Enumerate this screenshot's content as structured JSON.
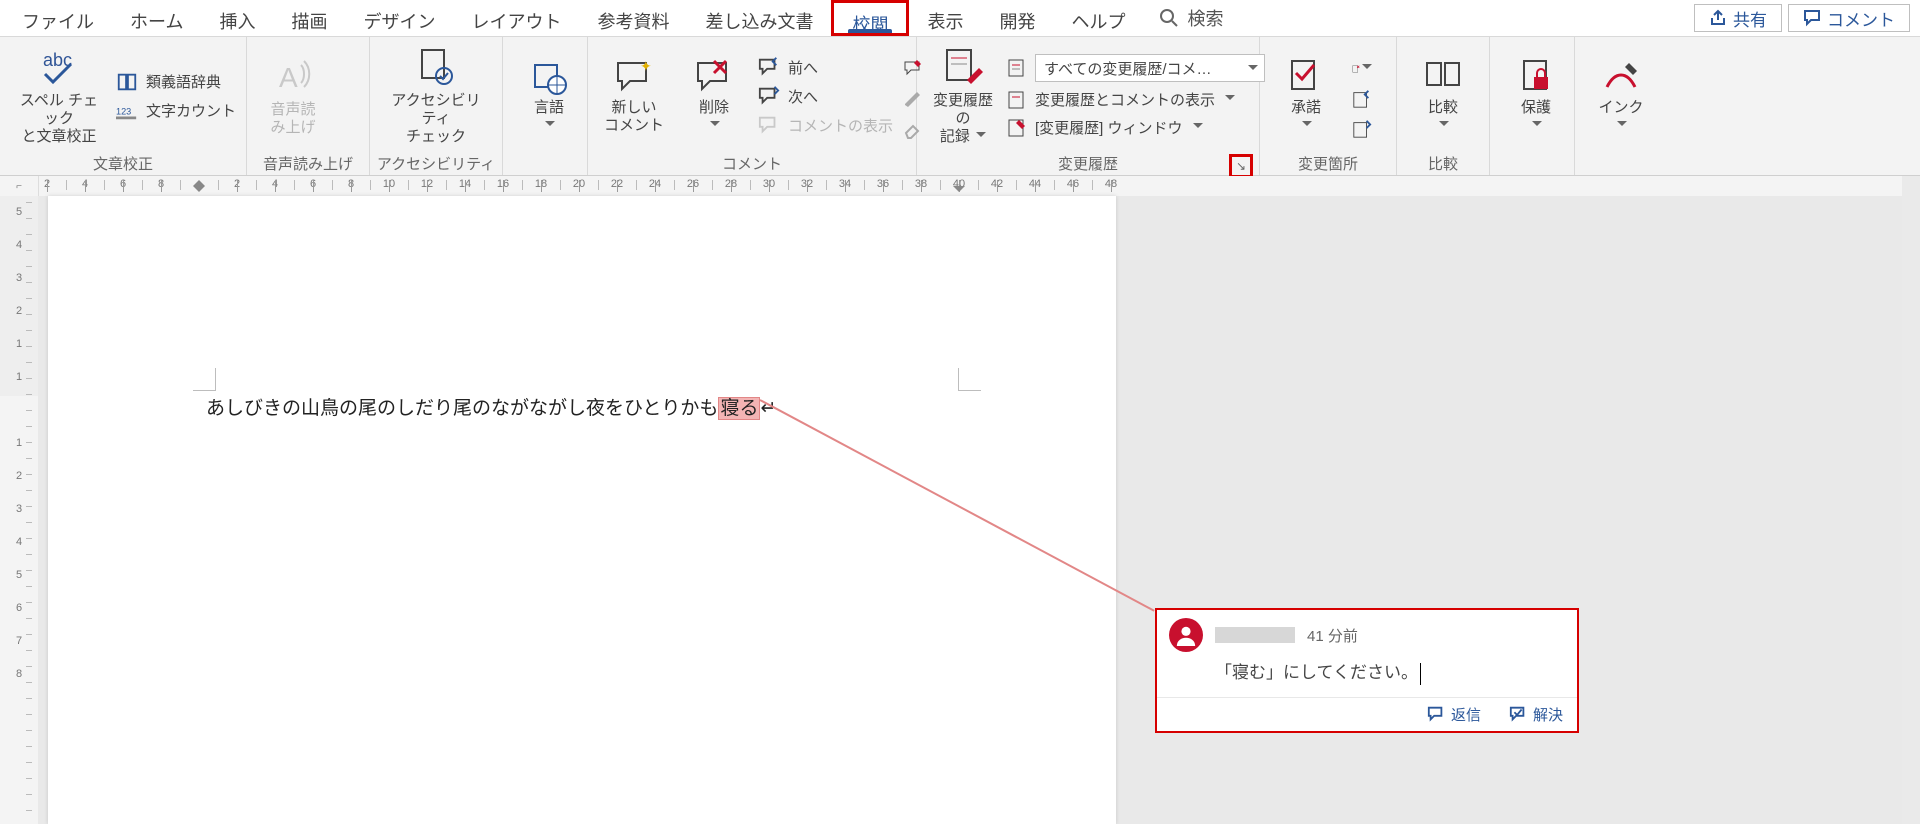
{
  "tabs": [
    "ファイル",
    "ホーム",
    "挿入",
    "描画",
    "デザイン",
    "レイアウト",
    "参考資料",
    "差し込み文書",
    "校閲",
    "表示",
    "開発",
    "ヘルプ"
  ],
  "active_tab_index": 8,
  "search_label": "検索",
  "title_buttons": {
    "share": "共有",
    "comments": "コメント"
  },
  "ribbon": {
    "proofing": {
      "spell": "スペル チェック\nと文章校正",
      "thesaurus": "類義語辞典",
      "wordcount": "文字カウント",
      "group": "文章校正"
    },
    "speech": {
      "read_aloud": "音声読\nみ上げ",
      "group": "音声読み上げ"
    },
    "accessibility": {
      "check": "アクセシビリティ\nチェック",
      "group": "アクセシビリティ"
    },
    "language": {
      "btn": "言語"
    },
    "comments": {
      "new": "新しい\nコメント",
      "delete": "削除",
      "prev": "前へ",
      "next": "次へ",
      "show": "コメントの表示",
      "group": "コメント"
    },
    "tracking": {
      "track": "変更履歴の\n記録",
      "markup_dropdown": "すべての変更履歴/コメ…",
      "show_markup": "変更履歴とコメントの表示",
      "pane": "[変更履歴] ウィンドウ",
      "group": "変更履歴"
    },
    "changes": {
      "accept": "承諾",
      "group": "変更箇所"
    },
    "compare": {
      "compare": "比較",
      "group": "比較"
    },
    "protect": {
      "protect": "保護"
    },
    "ink": {
      "ink": "インク"
    }
  },
  "hruler": {
    "left_numbers": [
      8,
      6,
      4,
      2
    ],
    "right_numbers": [
      2,
      4,
      6,
      8,
      10,
      12,
      14,
      16,
      18,
      20,
      22,
      24,
      26,
      28,
      30,
      32,
      34,
      36,
      38,
      40,
      42,
      44,
      46,
      48
    ]
  },
  "vruler": {
    "top_numbers": [
      5,
      4,
      3,
      2,
      1,
      1
    ],
    "bottom_numbers": [
      1,
      2,
      3,
      4,
      5,
      6,
      7,
      8
    ]
  },
  "doc": {
    "text_before": "あしびきの山鳥の尾のしだり尾のながながし夜をひとりかも",
    "text_hl": "寝る",
    "paramark": "↵"
  },
  "comment": {
    "timestamp": "41 分前",
    "body": "「寝む」にしてください。",
    "reply": "返信",
    "resolve": "解決"
  }
}
